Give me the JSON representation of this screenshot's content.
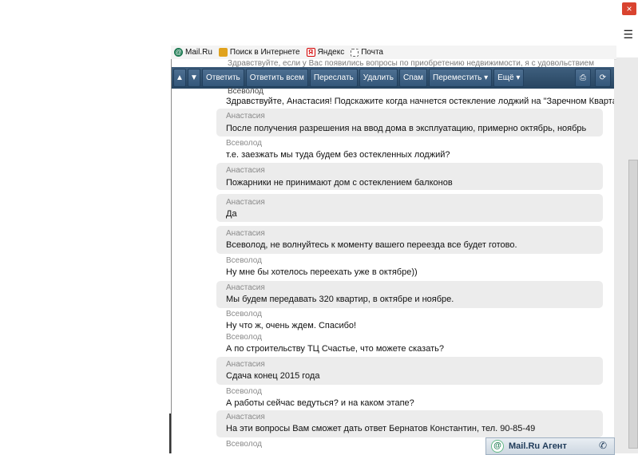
{
  "window": {
    "close_label": "×",
    "menu_label": "☰"
  },
  "links_bar": {
    "items": [
      {
        "label": "Mail.Ru",
        "icon": "mailru-icon"
      },
      {
        "label": "Поиск в Интернете",
        "icon": "search-icon"
      },
      {
        "label": "Яндекс",
        "icon": "yandex-icon",
        "glyph": "Я"
      },
      {
        "label": "Почта",
        "icon": "mail-icon"
      }
    ]
  },
  "background_text": "Здравствуйте, если у Вас появились вопросы по приобретению недвижимости, я с удовольствием",
  "background_text2": "Всеволод",
  "toolbar": {
    "up": "▲",
    "down": "▼",
    "buttons": [
      "Ответить",
      "Ответить всем",
      "Переслать",
      "Удалить",
      "Спам",
      "Переместить ▾",
      "Ещё ▾"
    ],
    "print": "⎙",
    "refresh": "⟳"
  },
  "messages": [
    {
      "name": "",
      "text": "Здравствуйте, Анастасия! Подскажите когда начнется остекление лоджий на \"Заречном Квартале\"",
      "shaded": false
    },
    {
      "name": "Анастасия",
      "text": "После получения разрешения на ввод дома в эксплуатацию, примерно октябрь, ноябрь",
      "shaded": true
    },
    {
      "name": "Всеволод",
      "text": "т.е. заезжать мы туда будем без остекленных лоджий?",
      "shaded": false
    },
    {
      "name": "Анастасия",
      "text": "Пожарники не принимают дом с остеклением балконов",
      "shaded": true
    },
    {
      "name": "Анастасия",
      "text": "Да",
      "shaded": true
    },
    {
      "name": "Анастасия",
      "text": "Всеволод, не волнуйтесь к моменту вашего переезда все будет готово.",
      "shaded": true
    },
    {
      "name": "Всеволод",
      "text": "Ну мне бы хотелось переехать уже в октябре))",
      "shaded": false
    },
    {
      "name": "Анастасия",
      "text": "Мы будем передавать 320 квартир, в октябре и ноябре.",
      "shaded": true
    },
    {
      "name": "Всеволод",
      "text": "Ну что ж, очень ждем. Спасибо!",
      "shaded": false
    },
    {
      "name": "Всеволод",
      "text": "А по строительству ТЦ Счастье, что можете сказать?",
      "shaded": false
    },
    {
      "name": "Анастасия",
      "text": "Сдача конец 2015 года",
      "shaded": true
    },
    {
      "name": "Всеволод",
      "text": "А работы сейчас ведуться? и на каком этапе?",
      "shaded": false
    },
    {
      "name": "Анастасия",
      "text": "На эти вопросы Вам сможет дать ответ Бернатов Константин, тел. 90-85-49",
      "shaded": true
    },
    {
      "name": "Всеволод",
      "text": "",
      "shaded": false
    }
  ],
  "agent": {
    "at": "@",
    "label": "Mail.Ru Агент",
    "phone": "✆"
  }
}
